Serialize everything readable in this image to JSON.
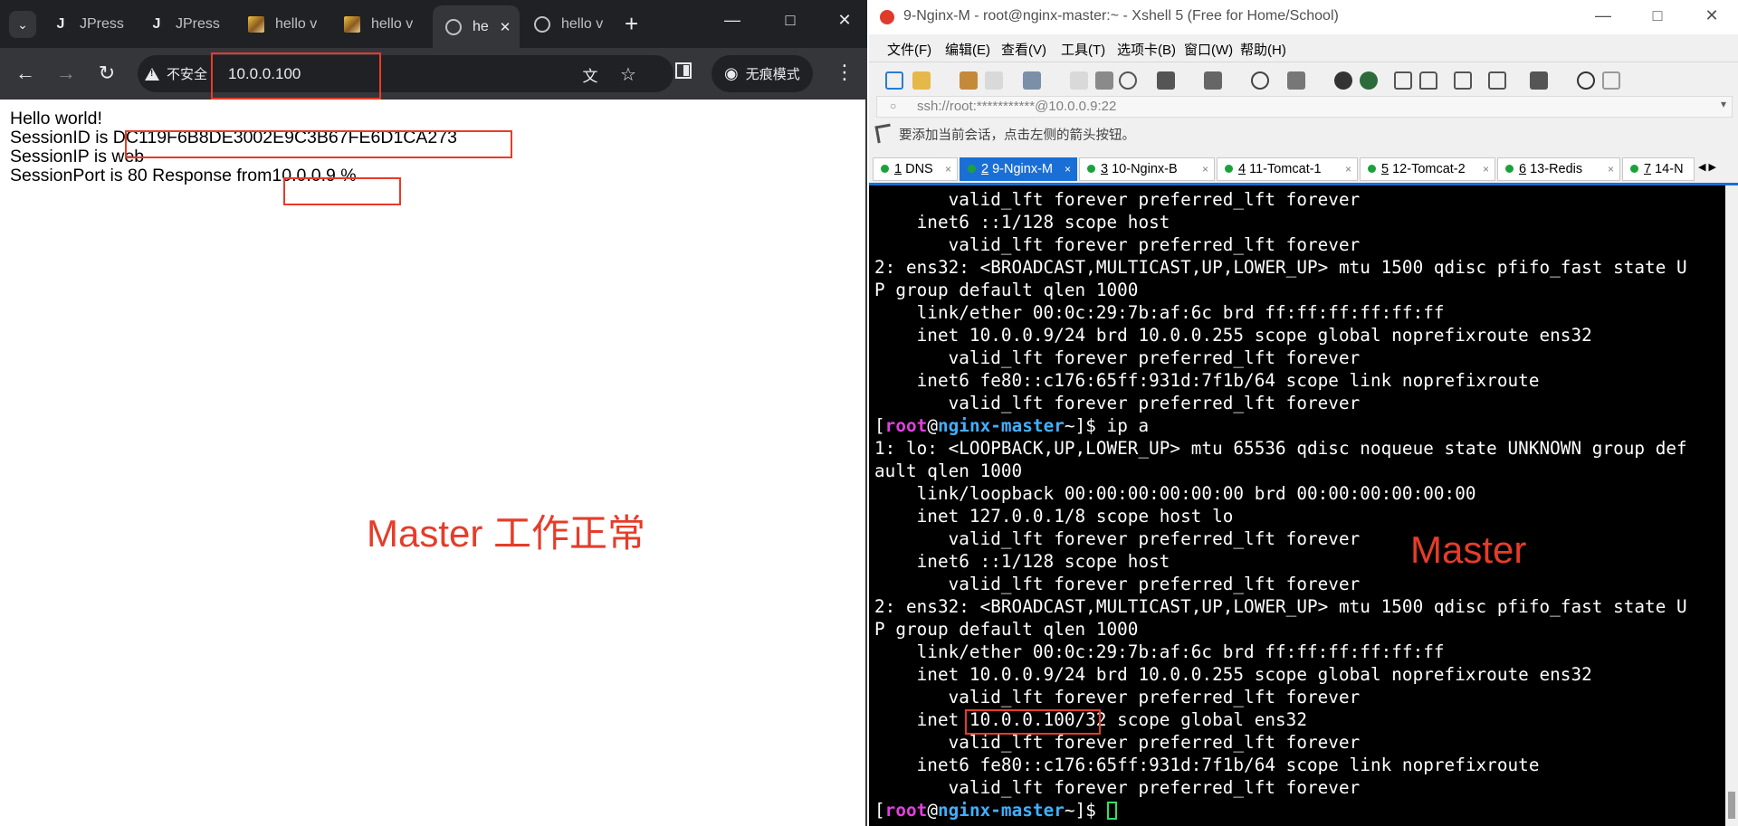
{
  "browser": {
    "tabs": [
      {
        "label": "JPress",
        "icon": "jpress-icon"
      },
      {
        "label": "JPress",
        "icon": "jpress-icon"
      },
      {
        "label": "hello v",
        "icon": "image-icon"
      },
      {
        "label": "hello v",
        "icon": "image-icon"
      },
      {
        "label": "he",
        "icon": "globe-icon",
        "active": true
      },
      {
        "label": "hello v",
        "icon": "globe-icon"
      }
    ],
    "security_label": "不安全",
    "url": "10.0.0.100",
    "incognito_label": "无痕模式",
    "page_lines": [
      "Hello world!",
      "SessionID is DC119F6B8DE3002E9C3B67FE6D1CA273",
      "SessionIP is web",
      "SessionPort is 80 Response from10.0.0.9 %"
    ],
    "annotation": "Master 工作正常",
    "accent_color": "#e63c2a"
  },
  "xshell": {
    "title": "9-Nginx-M - root@nginx-master:~ - Xshell 5 (Free for Home/School)",
    "menu": [
      "文件(F)",
      "编辑(E)",
      "查看(V)",
      "工具(T)",
      "选项卡(B)",
      "窗口(W)",
      "帮助(H)"
    ],
    "address": "ssh://root:***********@10.0.0.9:22",
    "hint": "要添加当前会话，点击左侧的箭头按钮。",
    "tabs": [
      {
        "num": "1",
        "label": "DNS"
      },
      {
        "num": "2",
        "label": "9-Nginx-M",
        "active": true
      },
      {
        "num": "3",
        "label": "10-Nginx-B"
      },
      {
        "num": "4",
        "label": "11-Tomcat-1"
      },
      {
        "num": "5",
        "label": "12-Tomcat-2"
      },
      {
        "num": "6",
        "label": "13-Redis"
      },
      {
        "num": "7",
        "label": "14-N"
      }
    ],
    "terminal_lines": [
      "       valid_lft forever preferred_lft forever",
      "    inet6 ::1/128 scope host",
      "       valid_lft forever preferred_lft forever",
      "2: ens32: <BROADCAST,MULTICAST,UP,LOWER_UP> mtu 1500 qdisc pfifo_fast state U",
      "P group default qlen 1000",
      "    link/ether 00:0c:29:7b:af:6c brd ff:ff:ff:ff:ff:ff",
      "    inet 10.0.0.9/24 brd 10.0.0.255 scope global noprefixroute ens32",
      "       valid_lft forever preferred_lft forever",
      "    inet6 fe80::c176:65ff:931d:7f1b/64 scope link noprefixroute",
      "       valid_lft forever preferred_lft forever",
      "PROMPT ip a",
      "1: lo: <LOOPBACK,UP,LOWER_UP> mtu 65536 qdisc noqueue state UNKNOWN group def",
      "ault qlen 1000",
      "    link/loopback 00:00:00:00:00:00 brd 00:00:00:00:00:00",
      "    inet 127.0.0.1/8 scope host lo",
      "       valid_lft forever preferred_lft forever",
      "    inet6 ::1/128 scope host",
      "       valid_lft forever preferred_lft forever",
      "2: ens32: <BROADCAST,MULTICAST,UP,LOWER_UP> mtu 1500 qdisc pfifo_fast state U",
      "P group default qlen 1000",
      "    link/ether 00:0c:29:7b:af:6c brd ff:ff:ff:ff:ff:ff",
      "    inet 10.0.0.9/24 brd 10.0.0.255 scope global noprefixroute ens32",
      "       valid_lft forever preferred_lft forever",
      "    inet 10.0.0.100/32 scope global ens32",
      "       valid_lft forever preferred_lft forever",
      "    inet6 fe80::c176:65ff:931d:7f1b/64 scope link noprefixroute",
      "       valid_lft forever preferred_lft forever",
      "PROMPT "
    ],
    "prompt": {
      "open": "[",
      "user": "root",
      "at": "@",
      "host": "nginx-master",
      "dir": "~",
      "close": "]$"
    },
    "annotation": "Master",
    "accent_color": "#1a6fd6"
  }
}
